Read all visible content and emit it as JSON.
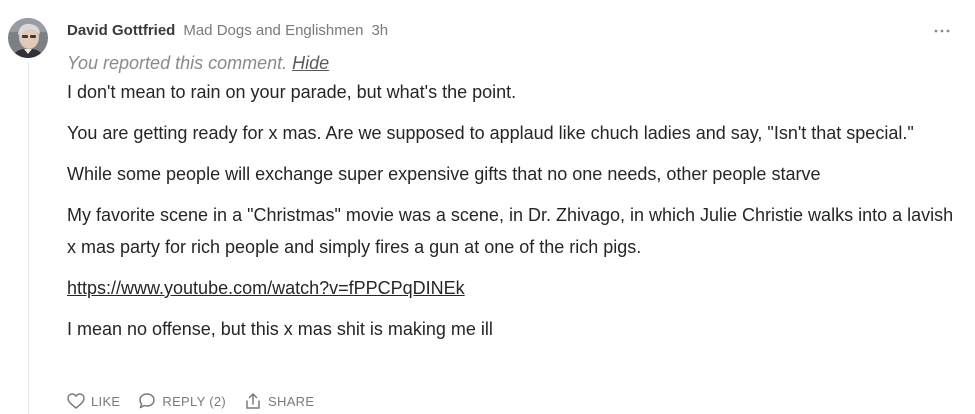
{
  "comment": {
    "author": "David Gottfried",
    "publication": "Mad Dogs and Englishmen",
    "time": "3h",
    "reported_notice": "You reported this comment.",
    "hide_label": "Hide",
    "paragraphs": [
      "I don't mean to rain on your parade, but what's the point.",
      "You are getting ready for x mas. Are we supposed to applaud like chuch ladies and say, \"Isn't that special.\"",
      "While some people will exchange super expensive gifts that no one needs, other people starve",
      "My favorite scene in a \"Christmas\" movie was a scene, in Dr. Zhivago, in which Julie Christie walks into a lavish x mas party for rich people and simply fires a gun at one of the rich pigs.",
      "https://www.youtube.com/watch?v=fPPCPqDINEk",
      "I mean no offense, but this x mas shit is making me ill"
    ]
  },
  "actions": {
    "like_label": "LIKE",
    "reply_label": "REPLY (2)",
    "share_label": "SHARE"
  },
  "icons": {
    "more": "ellipsis-icon",
    "like": "heart-icon",
    "reply": "speech-bubble-icon",
    "share": "share-icon"
  },
  "colors": {
    "text": "#262626",
    "muted": "#7a7a7a",
    "thread_line": "#e6e6e6"
  }
}
